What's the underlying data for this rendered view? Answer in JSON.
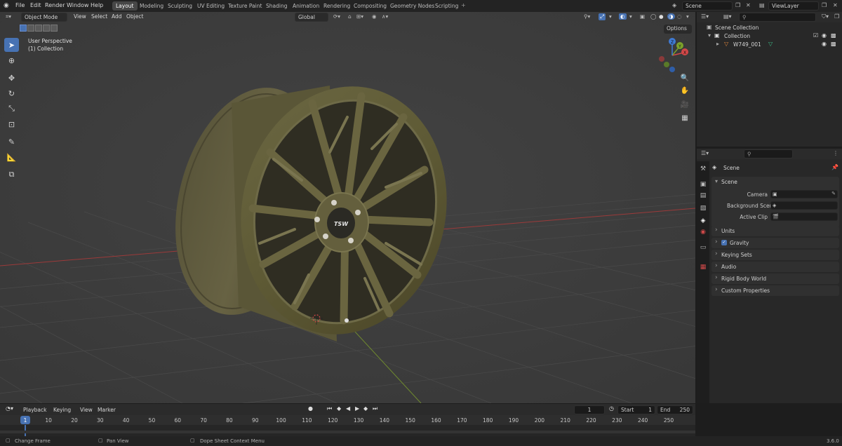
{
  "topbar": {
    "menus": [
      "File",
      "Edit",
      "Render",
      "Window",
      "Help"
    ],
    "workspaces": [
      "Layout",
      "Modeling",
      "Sculpting",
      "UV Editing",
      "Texture Paint",
      "Shading",
      "Animation",
      "Rendering",
      "Compositing",
      "Geometry Nodes",
      "Scripting"
    ],
    "active_workspace": "Layout",
    "add_tab": "+",
    "scene_name": "Scene",
    "view_layer": "ViewLayer"
  },
  "viewport": {
    "mode": "Object Mode",
    "menus": [
      "View",
      "Select",
      "Add",
      "Object"
    ],
    "transform_orientation": "Global",
    "options_label": "Options",
    "info_line1": "User Perspective",
    "info_line2": "(1) Collection",
    "logo_text": "TSW",
    "gizmo": {
      "x": "X",
      "y": "Y",
      "z": "Z"
    }
  },
  "outliner": {
    "root": "Scene Collection",
    "collection": "Collection",
    "object": "W749_001"
  },
  "properties": {
    "context": "Scene",
    "section": "Scene",
    "camera_label": "Camera",
    "background_label": "Background Scene",
    "clip_label": "Active Clip",
    "panels": [
      "Units",
      "Gravity",
      "Keying Sets",
      "Audio",
      "Rigid Body World",
      "Custom Properties"
    ]
  },
  "timeline": {
    "menus": [
      "Playback",
      "Keying",
      "View",
      "Marker"
    ],
    "current_frame": "1",
    "start_label": "Start",
    "start_value": "1",
    "end_label": "End",
    "end_value": "250",
    "frame_labels": [
      "1",
      "10",
      "20",
      "30",
      "40",
      "50",
      "60",
      "70",
      "80",
      "90",
      "100",
      "110",
      "120",
      "130",
      "140",
      "150",
      "160",
      "170",
      "180",
      "190",
      "200",
      "210",
      "220",
      "230",
      "240",
      "250"
    ]
  },
  "statusbar": {
    "hint1": "Change Frame",
    "hint2": "Pan View",
    "hint3": "Dope Sheet Context Menu",
    "version": "3.6.0"
  }
}
